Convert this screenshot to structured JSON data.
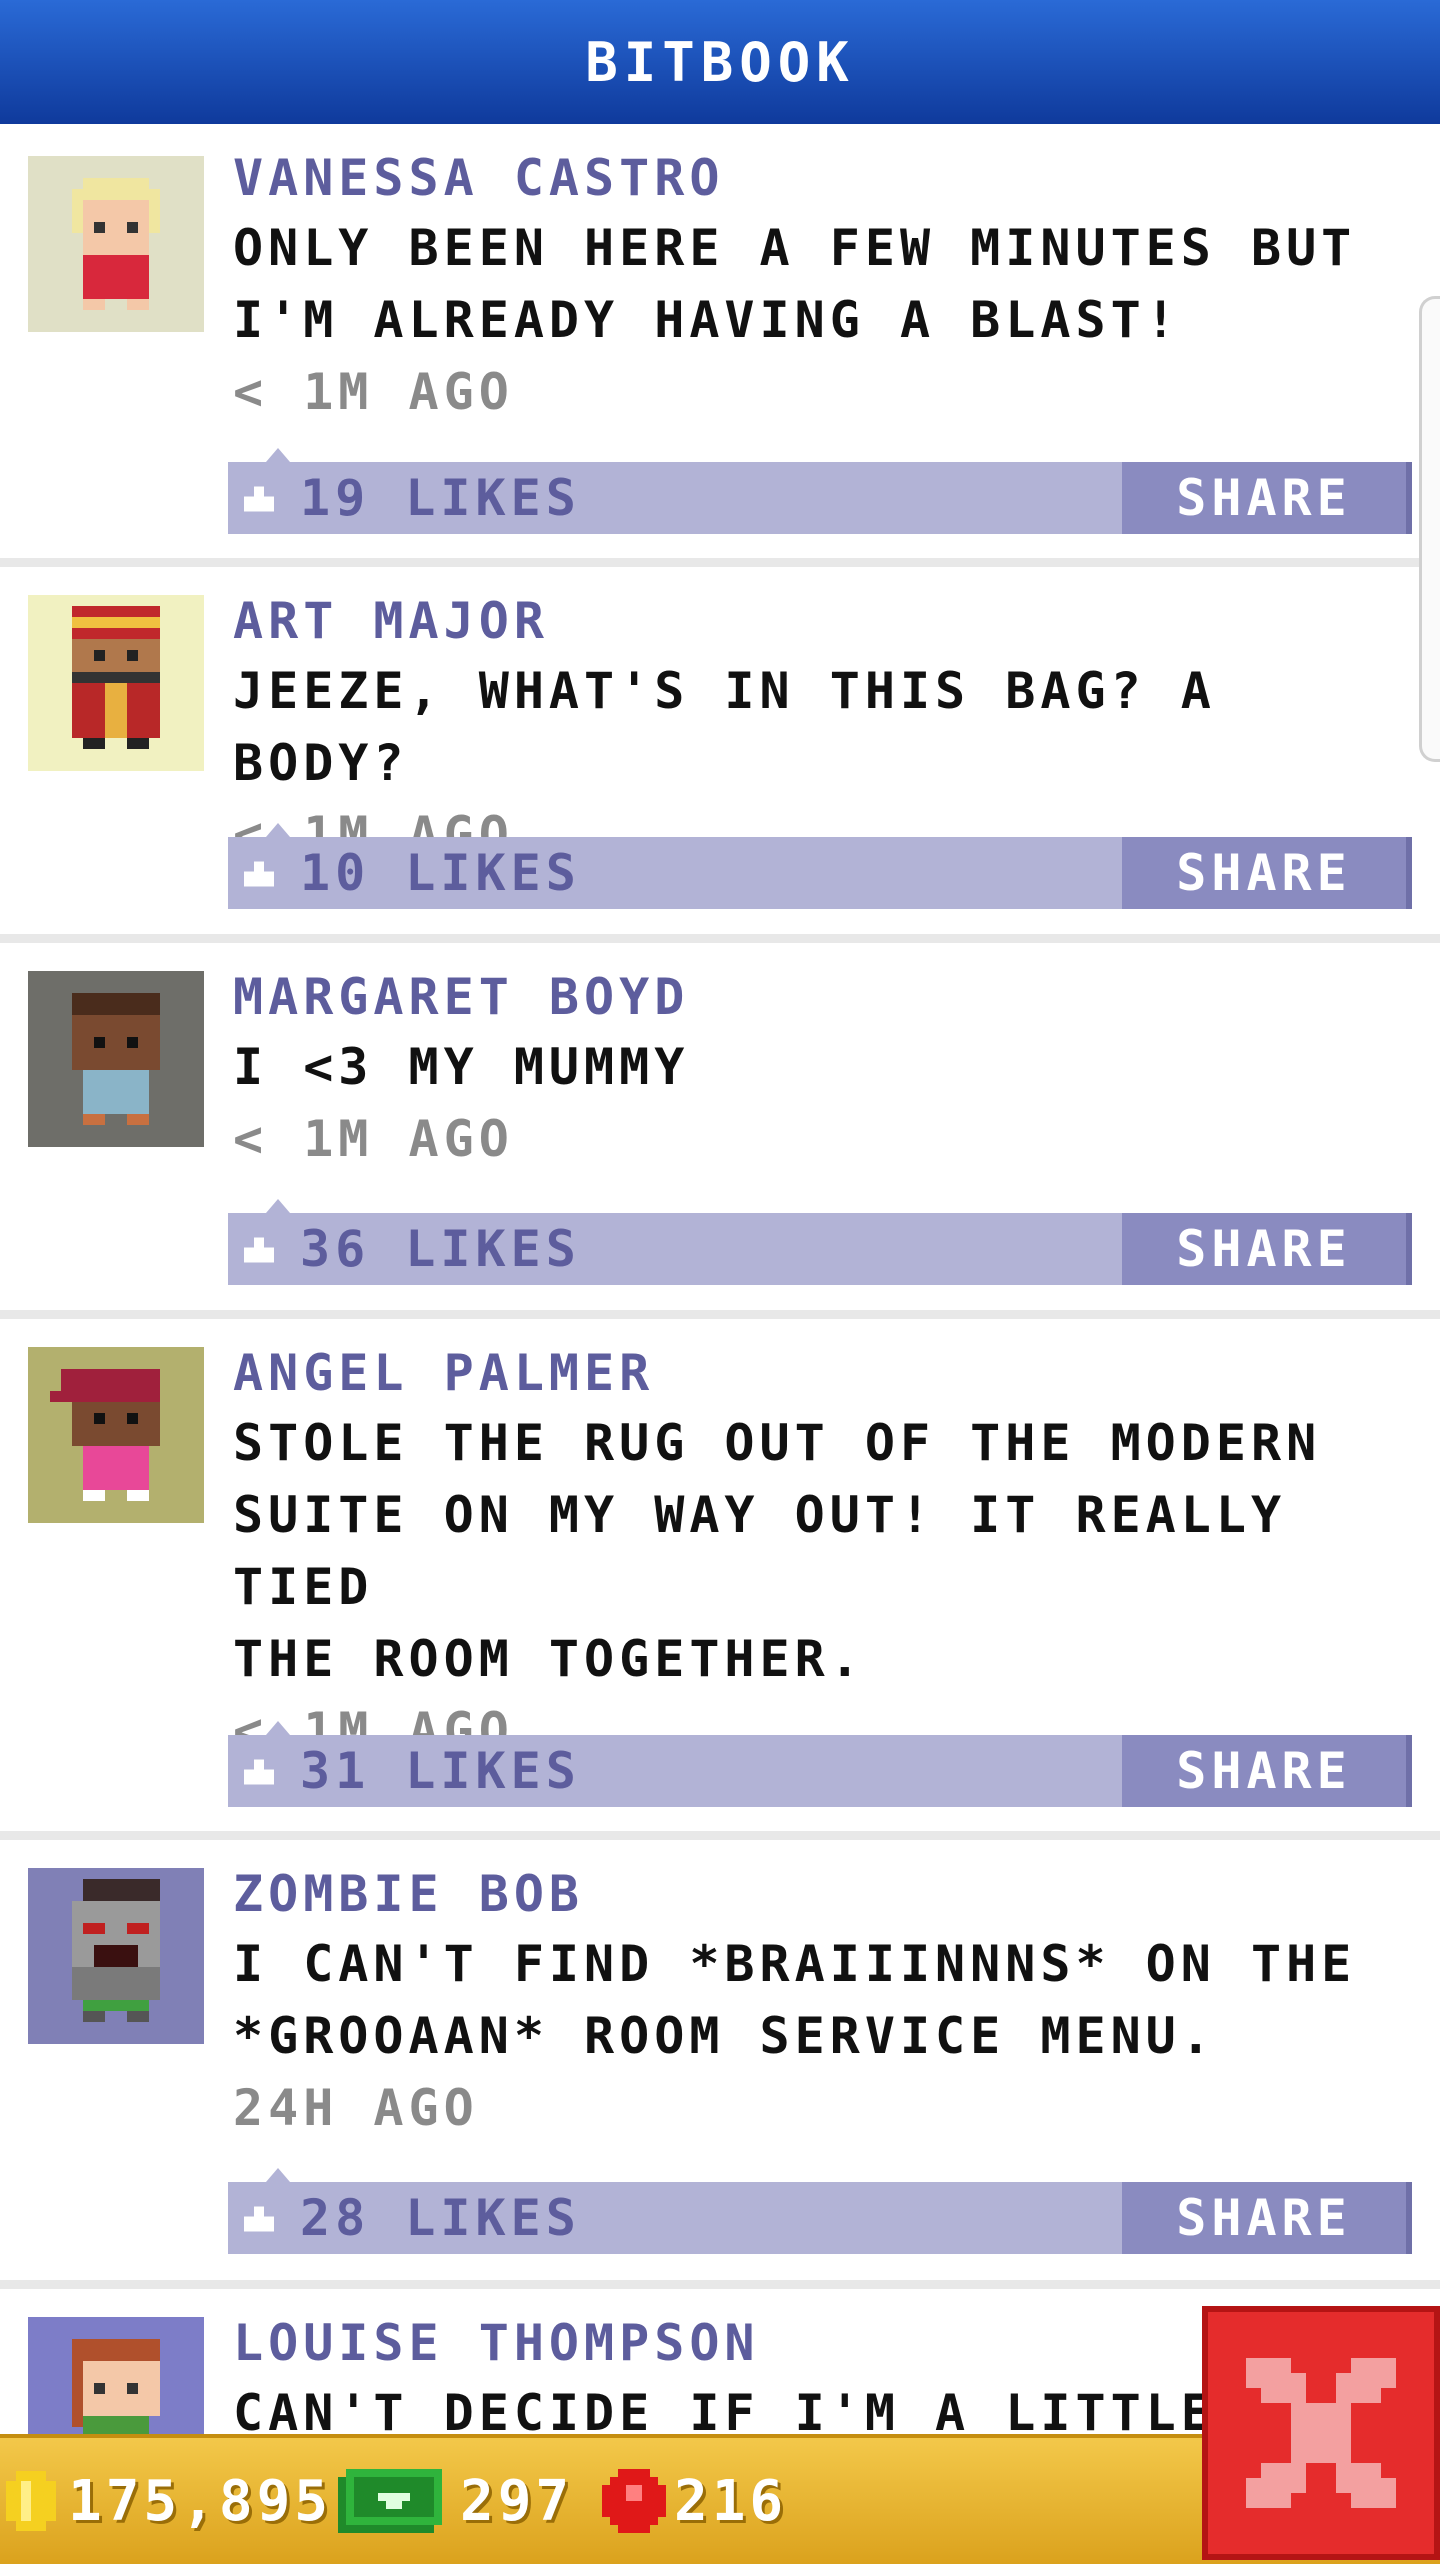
{
  "app": {
    "title": "BITBOOK"
  },
  "posts": [
    {
      "author": "VANESSA CASTRO",
      "lines": [
        "ONLY BEEN HERE A FEW MINUTES BUT",
        "I'M ALREADY HAVING A BLAST!"
      ],
      "time": "< 1M AGO",
      "likes": "19 LIKES",
      "share": "SHARE",
      "avatar_bg": "#e0e0c6"
    },
    {
      "author": "ART MAJOR",
      "lines": [
        "JEEZE, WHAT'S IN THIS BAG? A BODY?"
      ],
      "time": "< 1M AGO",
      "likes": "10 LIKES",
      "share": "SHARE",
      "avatar_bg": "#f1f1c1"
    },
    {
      "author": "MARGARET BOYD",
      "lines": [
        "I <3 MY MUMMY"
      ],
      "time": "< 1M AGO",
      "likes": "36 LIKES",
      "share": "SHARE",
      "avatar_bg": "#6e6e69"
    },
    {
      "author": "ANGEL PALMER",
      "lines": [
        "STOLE THE RUG OUT OF THE MODERN",
        "SUITE ON MY WAY OUT! IT REALLY TIED",
        "THE ROOM TOGETHER."
      ],
      "time": "< 1M AGO",
      "likes": "31 LIKES",
      "share": "SHARE",
      "avatar_bg": "#b3b06e"
    },
    {
      "author": "ZOMBIE BOB",
      "lines": [
        "I CAN'T FIND *BRAIIINNNS* ON THE",
        "*GROOAAN* ROOM SERVICE MENU."
      ],
      "time": "24H AGO",
      "likes": "28 LIKES",
      "share": "SHARE",
      "avatar_bg": "#8080b6"
    },
    {
      "author": "LOUISE THOMPSON",
      "lines": [
        "CAN'T DECIDE IF I'M A LITTLE BIT"
      ],
      "time": "",
      "likes": "",
      "share": "",
      "avatar_bg": "#7d7dc8"
    }
  ],
  "footer": {
    "coins": "175,895",
    "bux": "297",
    "gems": "216"
  },
  "colors": {
    "header": "#1a4fbf",
    "author": "#5d5d9d",
    "bar": "#b2b3d6",
    "share": "#8a8bc0",
    "footer": "#e8b52f",
    "close": "#e52c2c"
  },
  "icons": {
    "like": "thumbs-up-icon",
    "coin": "coin-icon",
    "bux": "bux-icon",
    "gem": "gem-icon",
    "close": "close-icon"
  }
}
